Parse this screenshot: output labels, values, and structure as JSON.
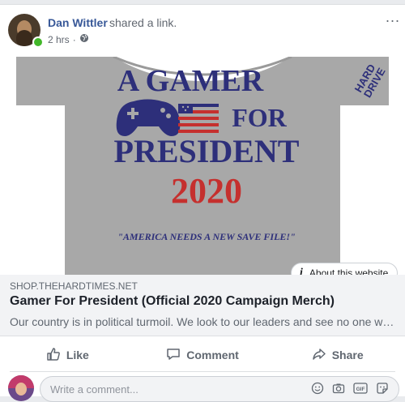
{
  "post": {
    "author": "Dan Wittler",
    "action": "shared a link.",
    "time": "2 hrs",
    "separator": "·",
    "privacy_icon": "globe-icon",
    "more_icon": "more-icon",
    "more_label": "..."
  },
  "shirt": {
    "line1": "A GAMER",
    "line2": "FOR",
    "line3": "PRESIDENT",
    "line4": "2020",
    "tagline": "\"AMERICA NEEDS A NEW SAVE FILE!\"",
    "sleeve_1": "HARD",
    "sleeve_2": "DRIVE",
    "shirt_color": "#a8a8a8",
    "blue": "#2d2f7a",
    "red": "#c5302e"
  },
  "link": {
    "about": "About this website",
    "about_icon": "info-icon",
    "domain": "SHOP.THEHARDTIMES.NET",
    "title": "Gamer For President (Official 2020 Campaign Merch)",
    "description": "Our country is in political turmoil. We look to our leaders and see no one who can lead us through these trying times."
  },
  "actions": {
    "like": "Like",
    "comment": "Comment",
    "share": "Share",
    "like_icon": "thumbs-up-icon",
    "comment_icon": "comment-icon",
    "share_icon": "share-icon"
  },
  "composer": {
    "placeholder": "Write a comment...",
    "icons": [
      "emoji-icon",
      "camera-icon",
      "gif-icon",
      "sticker-icon"
    ],
    "gif_label": "GIF"
  },
  "colors": {
    "link_blue": "#385898",
    "text_gray": "#606770",
    "online_green": "#42b72a"
  }
}
